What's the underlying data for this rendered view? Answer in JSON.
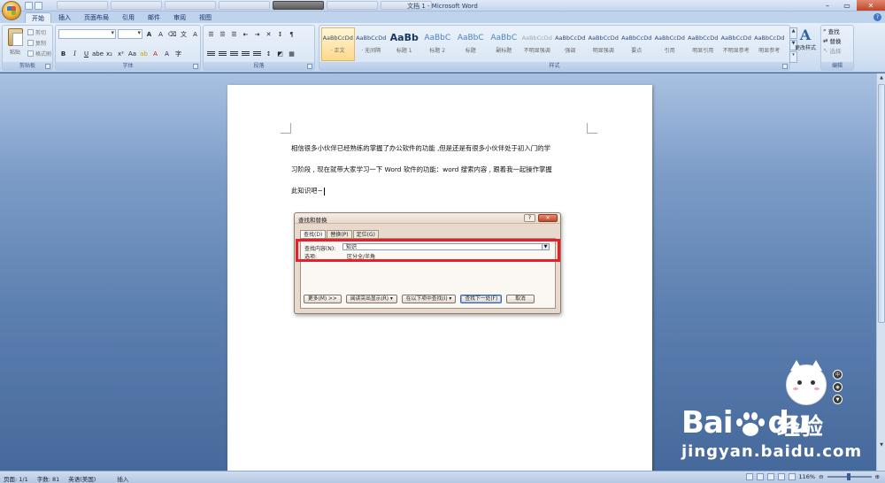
{
  "window": {
    "title": "文档 1 - Microsoft Word",
    "controls": [
      "–",
      "▭",
      "✕"
    ]
  },
  "ribbon": {
    "tabs": [
      {
        "label": "开始",
        "active": true
      },
      {
        "label": "插入"
      },
      {
        "label": "页面布局"
      },
      {
        "label": "引用"
      },
      {
        "label": "邮件"
      },
      {
        "label": "审阅"
      },
      {
        "label": "视图"
      }
    ],
    "clipboard": {
      "paste_label": "粘贴",
      "cut_label": "剪切",
      "copy_label": "复制",
      "format_painter_label": "格式刷",
      "group_label": "剪贴板"
    },
    "font_group_label": "字体",
    "paragraph_group_label": "段落",
    "styles_group_label": "样式",
    "editing_group_label": "编辑",
    "styles": [
      {
        "sample": "AaBbCcDd",
        "name": "· 正文",
        "selected": true
      },
      {
        "sample": "AaBbCcDd",
        "name": "· 无间隔"
      },
      {
        "sample": "AaBb",
        "name": "标题 1",
        "kind": "big"
      },
      {
        "sample": "AaBbC",
        "name": "标题 2",
        "kind": "mid"
      },
      {
        "sample": "AaBbC",
        "name": "标题",
        "kind": "mid"
      },
      {
        "sample": "AaBbC",
        "name": "副标题",
        "kind": "mid"
      },
      {
        "sample": "AaBbCcDd",
        "name": "不明显强调",
        "kind": "grey"
      },
      {
        "sample": "AaBbCcDd",
        "name": "强调"
      },
      {
        "sample": "AaBbCcDd",
        "name": "明显强调"
      },
      {
        "sample": "AaBbCcDd",
        "name": "要点"
      },
      {
        "sample": "AaBbCcDd",
        "name": "引用"
      },
      {
        "sample": "AaBbCcDd",
        "name": "明显引用"
      },
      {
        "sample": "AaBbCcDd",
        "name": "不明显参考"
      },
      {
        "sample": "AaBbCcDd",
        "name": "明显参考"
      }
    ],
    "change_styles_label": "更改样式",
    "edit": {
      "find_label": "查找",
      "replace_label": "替换",
      "select_label": "选择"
    }
  },
  "document": {
    "lines": [
      "相信很多小伙伴已经熟练的掌握了办公软件的功能 ,但是还是有很多小伙伴处于初入门的学",
      "习阶段 , 现在就带大家学习一下 Word 软件的功能：word 搜索内容 , 跟着我一起操作掌握",
      "此知识吧~"
    ]
  },
  "dialog": {
    "title": "查找和替换",
    "help": "?",
    "close": "✕",
    "tabs": [
      {
        "label": "查找(D)",
        "active": true
      },
      {
        "label": "替换(P)"
      },
      {
        "label": "定位(G)"
      }
    ],
    "find_label": "查找内容(N):",
    "find_value": "知识",
    "options_label": "选项:",
    "options_value": "区分全/半角",
    "buttons": [
      "更多(M) >>",
      "阅读突出显示(R) ▾",
      "在以下项中查找(I) ▾",
      "查找下一处(F)",
      "取消"
    ]
  },
  "status": {
    "page": "页面: 1/1",
    "words": "字数: 81",
    "language": "英语(美国)",
    "insert": "插入",
    "zoom": "116%"
  },
  "watermark": {
    "logo_a": "Bai",
    "logo_b": "du",
    "jingyan": "经验",
    "url": "jingyan.baidu.com"
  }
}
